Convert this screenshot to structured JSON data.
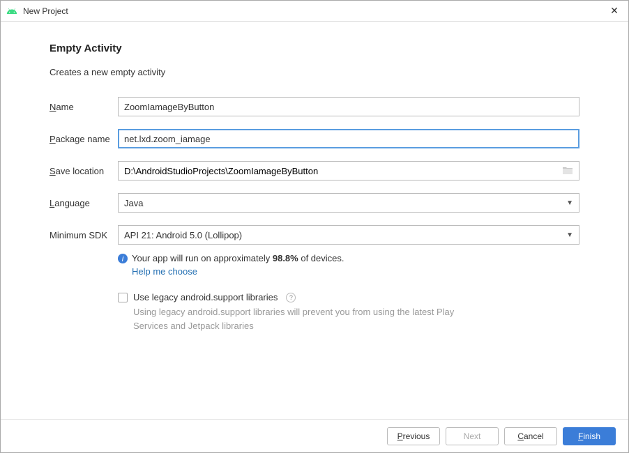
{
  "window": {
    "title": "New Project"
  },
  "page": {
    "title": "Empty Activity",
    "subtitle": "Creates a new empty activity"
  },
  "form": {
    "name": {
      "label_pre": "N",
      "label_rest": "ame",
      "value": "ZoomIamageByButton"
    },
    "package": {
      "label_pre": "P",
      "label_rest": "ackage name",
      "value": "net.lxd.zoom_iamage"
    },
    "save": {
      "label_pre": "S",
      "label_rest": "ave location",
      "value": "D:\\AndroidStudioProjects\\ZoomIamageByButton"
    },
    "language": {
      "label_pre": "L",
      "label_rest": "anguage",
      "value": "Java"
    },
    "minsdk": {
      "label": "Minimum SDK",
      "value": "API 21: Android 5.0 (Lollipop)"
    }
  },
  "info": {
    "text_a": "Your app will run on approximately ",
    "percent": "98.8%",
    "text_b": " of devices.",
    "link": "Help me choose"
  },
  "legacy": {
    "label": "Use legacy android.support libraries",
    "desc": "Using legacy android.support libraries will prevent you from using the latest Play Services and Jetpack libraries"
  },
  "buttons": {
    "previous": "revious",
    "previous_u": "P",
    "next": "Next",
    "cancel": "ancel",
    "cancel_u": "C",
    "finish": "inish",
    "finish_u": "F"
  }
}
